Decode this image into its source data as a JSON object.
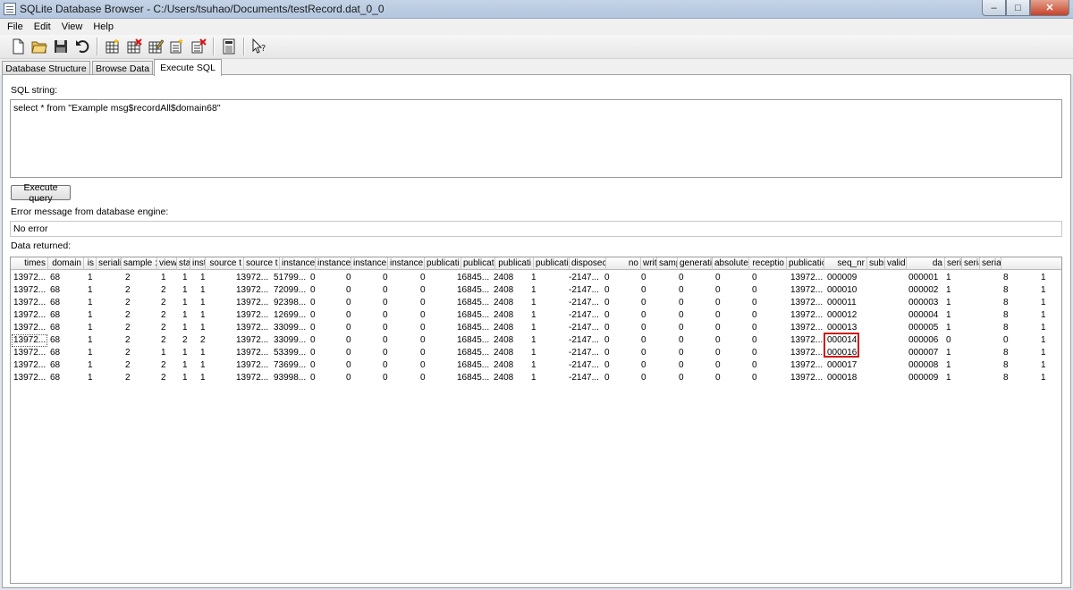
{
  "window": {
    "title": "SQLite Database Browser - C:/Users/tsuhao/Documents/testRecord.dat_0_0",
    "minimize": "–",
    "maximize": "□",
    "close": "✕"
  },
  "menu": [
    "File",
    "Edit",
    "View",
    "Help"
  ],
  "toolbar": {
    "icons": [
      "new-database-icon",
      "open-database-icon",
      "save-icon",
      "undo-icon",
      "create-table-icon",
      "delete-table-icon",
      "modify-table-icon",
      "create-index-icon",
      "delete-index-icon",
      "sql-log-icon",
      "whats-this-icon"
    ]
  },
  "tabs": [
    {
      "label": "Database Structure"
    },
    {
      "label": "Browse Data"
    },
    {
      "label": "Execute SQL",
      "active": true
    }
  ],
  "sql": {
    "label": "SQL string:",
    "query": "select * from \"Example msg$recordAll$domain68\"",
    "execute_button": "Execute query"
  },
  "error": {
    "label": "Error message from database engine:",
    "message": "No error"
  },
  "data": {
    "label": "Data returned:",
    "columns": [
      "times",
      "domain",
      "is",
      "seriali",
      "sample :",
      "view",
      "sta",
      "instance",
      "source t",
      "source t",
      "instance",
      "instance",
      "instance",
      "instance",
      "publicati",
      "publicati",
      "publicati",
      "publicati",
      "disposec",
      "no",
      "write",
      "sample :",
      "generati",
      "absolute",
      "receptio",
      "publication",
      "seq_nr",
      "subscript",
      "valid",
      "da",
      "seria",
      "serializec",
      "seria"
    ],
    "rows": [
      [
        "13972...",
        "68",
        "1",
        "2",
        "1",
        "1",
        "1",
        "13972...",
        "51799...",
        "0",
        "0",
        "0",
        "0",
        "16845...",
        "2408",
        "1",
        "-2147...",
        "0",
        "0",
        "0",
        "0",
        "0",
        "13972...",
        "000009",
        "",
        "000001",
        "1",
        "",
        "8",
        "1"
      ],
      [
        "13972...",
        "68",
        "1",
        "2",
        "2",
        "1",
        "1",
        "13972...",
        "72099...",
        "0",
        "0",
        "0",
        "0",
        "16845...",
        "2408",
        "1",
        "-2147...",
        "0",
        "0",
        "0",
        "0",
        "0",
        "13972...",
        "000010",
        "",
        "000002",
        "1",
        "",
        "8",
        "1"
      ],
      [
        "13972...",
        "68",
        "1",
        "2",
        "2",
        "1",
        "1",
        "13972...",
        "92398...",
        "0",
        "0",
        "0",
        "0",
        "16845...",
        "2408",
        "1",
        "-2147...",
        "0",
        "0",
        "0",
        "0",
        "0",
        "13972...",
        "000011",
        "",
        "000003",
        "1",
        "",
        "8",
        "1"
      ],
      [
        "13972...",
        "68",
        "1",
        "2",
        "2",
        "1",
        "1",
        "13972...",
        "12699...",
        "0",
        "0",
        "0",
        "0",
        "16845...",
        "2408",
        "1",
        "-2147...",
        "0",
        "0",
        "0",
        "0",
        "0",
        "13972...",
        "000012",
        "",
        "000004",
        "1",
        "",
        "8",
        "1"
      ],
      [
        "13972...",
        "68",
        "1",
        "2",
        "2",
        "1",
        "1",
        "13972...",
        "33099...",
        "0",
        "0",
        "0",
        "0",
        "16845...",
        "2408",
        "1",
        "-2147...",
        "0",
        "0",
        "0",
        "0",
        "0",
        "13972...",
        "000013",
        "",
        "000005",
        "1",
        "",
        "8",
        "1"
      ],
      [
        "13972...",
        "68",
        "1",
        "2",
        "2",
        "2",
        "2",
        "13972...",
        "33099...",
        "0",
        "0",
        "0",
        "0",
        "16845...",
        "2408",
        "1",
        "-2147...",
        "0",
        "0",
        "0",
        "0",
        "0",
        "13972...",
        "000014",
        "",
        "000006",
        "0",
        "",
        "0",
        "1"
      ],
      [
        "13972...",
        "68",
        "1",
        "2",
        "1",
        "1",
        "1",
        "13972...",
        "53399...",
        "0",
        "0",
        "0",
        "0",
        "16845...",
        "2408",
        "1",
        "-2147...",
        "0",
        "0",
        "0",
        "0",
        "0",
        "13972...",
        "000016",
        "",
        "000007",
        "1",
        "",
        "8",
        "1"
      ],
      [
        "13972...",
        "68",
        "1",
        "2",
        "2",
        "1",
        "1",
        "13972...",
        "73699...",
        "0",
        "0",
        "0",
        "0",
        "16845...",
        "2408",
        "1",
        "-2147...",
        "0",
        "0",
        "0",
        "0",
        "0",
        "13972...",
        "000017",
        "",
        "000008",
        "1",
        "",
        "8",
        "1"
      ],
      [
        "13972...",
        "68",
        "1",
        "2",
        "2",
        "1",
        "1",
        "13972...",
        "93998...",
        "0",
        "0",
        "0",
        "0",
        "16845...",
        "2408",
        "1",
        "-2147...",
        "0",
        "0",
        "0",
        "0",
        "0",
        "13972...",
        "000018",
        "",
        "000009",
        "1",
        "",
        "8",
        "1"
      ]
    ]
  }
}
